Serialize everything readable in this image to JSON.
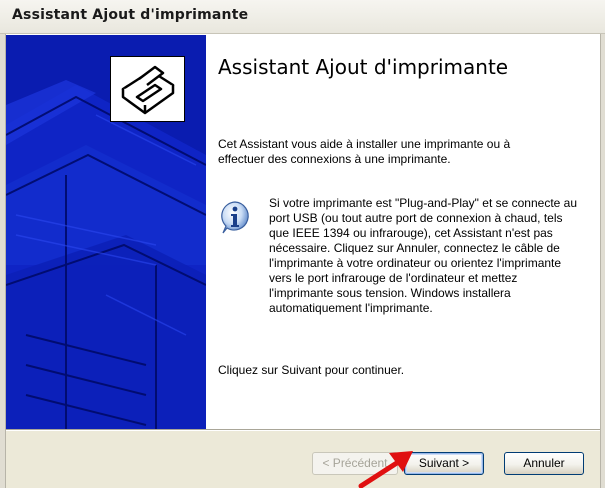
{
  "window": {
    "title": "Assistant Ajout d'imprimante"
  },
  "content": {
    "heading": "Assistant Ajout d'imprimante",
    "intro": "Cet Assistant vous aide à installer une imprimante ou à effectuer des connexions à une imprimante.",
    "info": "Si votre imprimante est \"Plug-and-Play\" et se connecte au port USB (ou tout autre port de connexion à chaud, tels que IEEE 1394 ou infrarouge), cet Assistant n'est pas nécessaire. Cliquez sur Annuler, connectez le câble de l'imprimante à votre ordinateur ou orientez l'imprimante vers le port infrarouge de l'ordinateur et mettez l'imprimante sous tension. Windows installera automatiquement l'imprimante.",
    "footer": "Cliquez sur Suivant pour continuer."
  },
  "buttons": {
    "previous": "< Précédent",
    "next": "Suivant >",
    "cancel": "Annuler"
  },
  "colors": {
    "banner": "#0a1cb0",
    "arrow": "#e01010"
  },
  "icons": {
    "wizard_logo": "printer-icon",
    "info": "info-icon",
    "annotation": "red-arrow-icon"
  }
}
